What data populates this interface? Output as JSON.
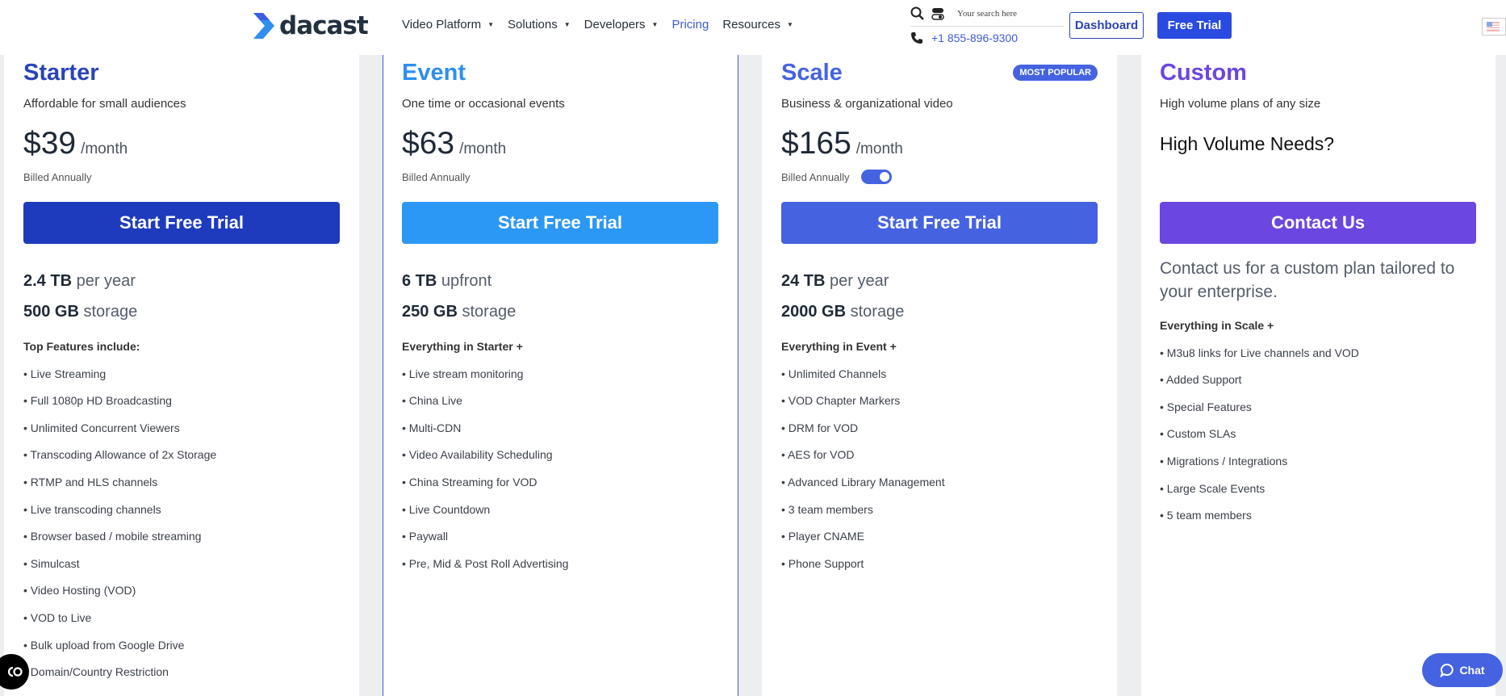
{
  "header": {
    "logo_text": "dacast",
    "nav": [
      {
        "label": "Video Platform",
        "has_dropdown": true,
        "active": false
      },
      {
        "label": "Solutions",
        "has_dropdown": true,
        "active": false
      },
      {
        "label": "Developers",
        "has_dropdown": true,
        "active": false
      },
      {
        "label": "Pricing",
        "has_dropdown": false,
        "active": true
      },
      {
        "label": "Resources",
        "has_dropdown": true,
        "active": false
      }
    ],
    "search_placeholder": "Your search here",
    "phone": "+1 855-896-9300",
    "dashboard_label": "Dashboard",
    "free_trial_label": "Free Trial",
    "icons": {
      "search": "search-icon",
      "toggle": "toggle-switch-icon",
      "phone": "phone-icon",
      "flag": "us-flag-icon"
    }
  },
  "plans": [
    {
      "name": "Starter",
      "color": "#2a43b8",
      "tagline": "Affordable for small audiences",
      "price": "$39",
      "period": "/month",
      "billing": "Billed Annually",
      "cta": "Start Free Trial",
      "cta_color": "#1f3bbd",
      "bandwidth_value": "2.4 TB",
      "bandwidth_unit": "per year",
      "storage_value": "500 GB",
      "storage_unit": "storage",
      "features_heading": "Top Features include:",
      "features": [
        "Live Streaming",
        "Full 1080p HD Broadcasting",
        "Unlimited Concurrent Viewers",
        "Transcoding Allowance of 2x Storage",
        "RTMP and HLS channels",
        "Live transcoding channels",
        "Browser based / mobile streaming",
        "Simulcast",
        "Video Hosting (VOD)",
        "VOD to Live",
        "Bulk upload from Google Drive",
        "Domain/Country Restriction"
      ]
    },
    {
      "name": "Event",
      "color": "#2d8ff0",
      "tagline": "One time or occasional events",
      "price": "$63",
      "period": "/month",
      "billing": "Billed Annually",
      "cta": "Start Free Trial",
      "cta_color": "#2b98f5",
      "bandwidth_value": "6 TB",
      "bandwidth_unit": "upfront",
      "storage_value": "250 GB",
      "storage_unit": "storage",
      "features_heading": "Everything in Starter +",
      "features": [
        "Live stream monitoring",
        "China Live",
        "Multi-CDN",
        "Video Availability Scheduling",
        "China Streaming for VOD",
        "Live Countdown",
        "Paywall",
        "Pre, Mid & Post Roll Advertising"
      ]
    },
    {
      "name": "Scale",
      "color": "#4563e0",
      "badge": "MOST POPULAR",
      "tagline": "Business & organizational video",
      "price": "$165",
      "period": "/month",
      "billing": "Billed Annually",
      "billing_toggle_on": true,
      "cta": "Start Free Trial",
      "cta_color": "#4563e0",
      "bandwidth_value": "24 TB",
      "bandwidth_unit": "per year",
      "storage_value": "2000 GB",
      "storage_unit": "storage",
      "features_heading": "Everything in Event +",
      "features": [
        "Unlimited Channels",
        "VOD Chapter Markers",
        "DRM for VOD",
        "AES for VOD",
        "Advanced Library Management",
        "3 team members",
        "Player CNAME",
        "Phone Support"
      ]
    },
    {
      "name": "Custom",
      "color": "#6c46e0",
      "tagline": "High volume plans of any size",
      "headline": "High Volume Needs?",
      "cta": "Contact Us",
      "cta_color": "#6c46e0",
      "contact_text": "Contact us for a custom plan tailored to your enterprise.",
      "features_heading": "Everything in Scale +",
      "features": [
        "M3u8 links for Live channels and VOD",
        "Added Support",
        "Special Features",
        "Custom SLAs",
        "Migrations / Integrations",
        "Large Scale Events",
        "5 team members"
      ]
    }
  ],
  "chat_label": "Chat",
  "accessibility_icon": "accessibility-icon"
}
